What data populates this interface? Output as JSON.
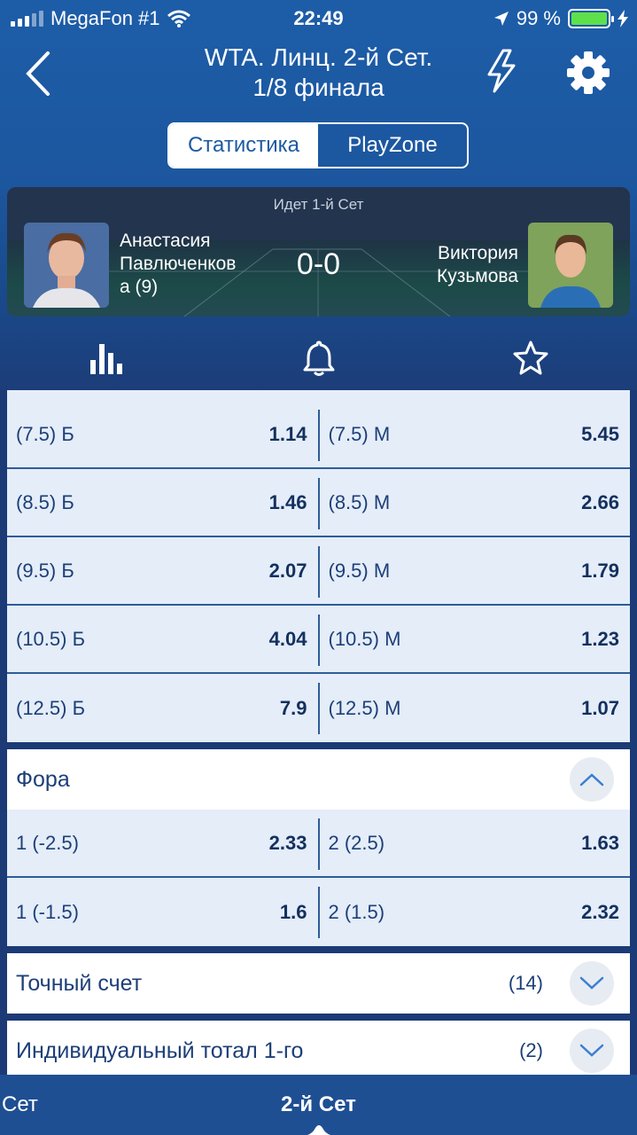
{
  "status_bar": {
    "carrier": "MegaFon #1",
    "time": "22:49",
    "battery": "99 %",
    "battery_level": 0.99
  },
  "header": {
    "title_line1": "WTA. Линц. 2-й Сет.",
    "title_line2": "1/8 финала",
    "back_icon": "chevron-left-icon",
    "flash_icon": "lightning-icon",
    "settings_icon": "gear-icon"
  },
  "tabs": {
    "stats_label": "Статистика",
    "playzone_label": "PlayZone"
  },
  "match": {
    "status": "Идет 1-й Сет",
    "player1_line1": "Анастасия",
    "player1_line2": "Павлюченков",
    "player1_line3": "а (9)",
    "player2_line1": "Виктория",
    "player2_line2": "Кузьмова",
    "score": "0-0"
  },
  "actions": {
    "stats_icon": "bar-chart-icon",
    "notify_icon": "bell-icon",
    "favorite_icon": "star-icon"
  },
  "total_rows": [
    {
      "left_label": "(7.5) Б",
      "left_value": "1.14",
      "right_label": "(7.5) М",
      "right_value": "5.45"
    },
    {
      "left_label": "(8.5) Б",
      "left_value": "1.46",
      "right_label": "(8.5) М",
      "right_value": "2.66"
    },
    {
      "left_label": "(9.5) Б",
      "left_value": "2.07",
      "right_label": "(9.5) М",
      "right_value": "1.79"
    },
    {
      "left_label": "(10.5) Б",
      "left_value": "4.04",
      "right_label": "(10.5) М",
      "right_value": "1.23"
    },
    {
      "left_label": "(12.5) Б",
      "left_value": "7.9",
      "right_label": "(12.5) М",
      "right_value": "1.07"
    }
  ],
  "handicap": {
    "title": "Фора",
    "rows": [
      {
        "left_label": "1 (-2.5)",
        "left_value": "2.33",
        "right_label": "2 (2.5)",
        "right_value": "1.63"
      },
      {
        "left_label": "1 (-1.5)",
        "left_value": "1.6",
        "right_label": "2 (1.5)",
        "right_value": "2.32"
      }
    ]
  },
  "exact_score": {
    "title": "Точный счет",
    "count": "(14)"
  },
  "individual_total": {
    "title": "Индивидуальный тотал 1-го",
    "count": "(2)"
  },
  "bottom_bar": {
    "prev_tab": "Сет",
    "active_tab": "2-й Сет"
  },
  "colors": {
    "header_blue": "#1d5da8",
    "odds_bg": "#e4edf8",
    "text_navy": "#1d3f78",
    "battery_green": "#5ee04b"
  }
}
